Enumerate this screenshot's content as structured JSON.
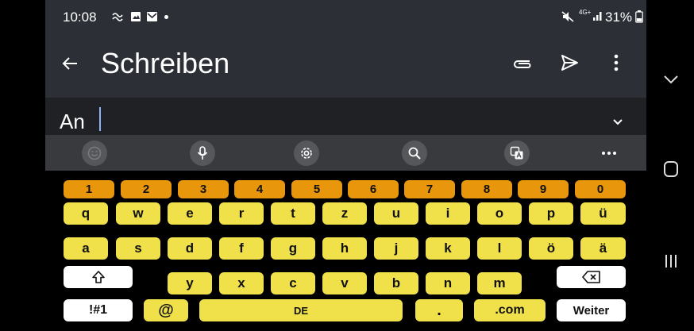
{
  "status": {
    "time": "10:08",
    "network": "4G+",
    "battery": "31%"
  },
  "appbar": {
    "title": "Schreiben"
  },
  "compose": {
    "to_label": "An"
  },
  "keyboard": {
    "numbers": [
      "1",
      "2",
      "3",
      "4",
      "5",
      "6",
      "7",
      "8",
      "9",
      "0"
    ],
    "row1": [
      "q",
      "w",
      "e",
      "r",
      "t",
      "z",
      "u",
      "i",
      "o",
      "p",
      "ü"
    ],
    "row2": [
      "a",
      "s",
      "d",
      "f",
      "g",
      "h",
      "j",
      "k",
      "l",
      "ö",
      "ä"
    ],
    "row3": [
      "y",
      "x",
      "c",
      "v",
      "b",
      "n",
      "m"
    ],
    "symbols_label": "!#1",
    "at_label": "@",
    "space_label": "DE",
    "period_label": ".",
    "com_label": ".com",
    "enter_label": "Weiter"
  }
}
